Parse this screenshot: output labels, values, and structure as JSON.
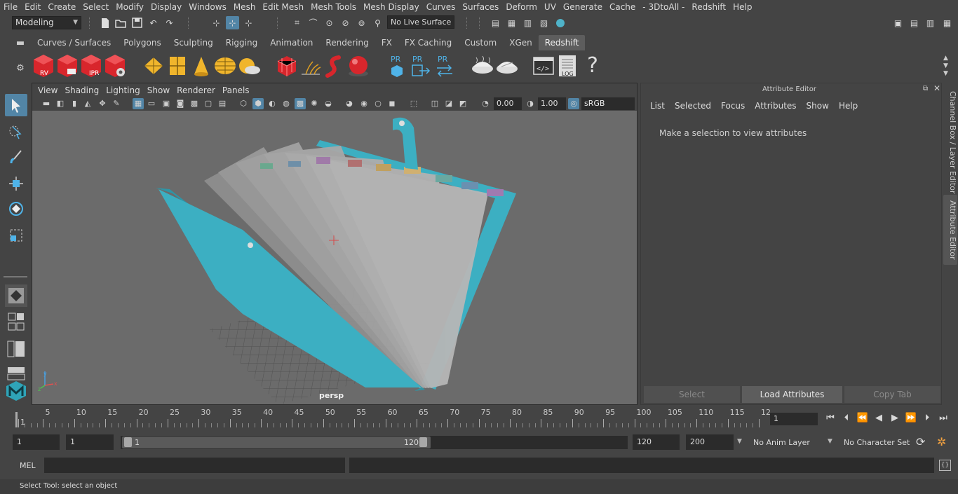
{
  "menu": [
    "File",
    "Edit",
    "Create",
    "Select",
    "Modify",
    "Display",
    "Windows",
    "Mesh",
    "Edit Mesh",
    "Mesh Tools",
    "Mesh Display",
    "Curves",
    "Surfaces",
    "Deform",
    "UV",
    "Generate",
    "Cache",
    "- 3DtoAll -",
    "Redshift",
    "Help"
  ],
  "status_line": {
    "workspace": "Modeling",
    "live_surface": "No Live Surface"
  },
  "shelf": {
    "tabs": [
      "Curves / Surfaces",
      "Polygons",
      "Sculpting",
      "Rigging",
      "Animation",
      "Rendering",
      "FX",
      "FX Caching",
      "Custom",
      "XGen",
      "Redshift"
    ],
    "active_tab": "Redshift",
    "icon_labels": {
      "rv": "RV",
      "ipr": "IPR",
      "pr1": "PR",
      "pr2": "PR",
      "pr3": "PR",
      "log": "LOG",
      "help": "?"
    }
  },
  "viewport": {
    "menu": [
      "View",
      "Shading",
      "Lighting",
      "Show",
      "Renderer",
      "Panels"
    ],
    "near_value": "0.00",
    "far_value": "1.00",
    "color_space": "sRGB gamma",
    "camera_label": "persp"
  },
  "attribute_editor": {
    "title": "Attribute Editor",
    "menu": [
      "List",
      "Selected",
      "Focus",
      "Attributes",
      "Show",
      "Help"
    ],
    "message": "Make a selection to view attributes",
    "buttons": {
      "select": "Select",
      "load": "Load Attributes",
      "copy": "Copy Tab"
    },
    "side_tabs": {
      "channel_box": "Channel Box / Layer Editor",
      "attribute_editor": "Attribute Editor"
    }
  },
  "time_slider": {
    "ticks": [
      "1",
      "5",
      "10",
      "15",
      "20",
      "25",
      "30",
      "35",
      "40",
      "45",
      "50",
      "55",
      "60",
      "65",
      "70",
      "75",
      "80",
      "85",
      "90",
      "95",
      "100",
      "105",
      "110",
      "115",
      "12"
    ],
    "current_frame": "1"
  },
  "range_slider": {
    "start_time": "1",
    "start_playback": "1",
    "handle_start": "1",
    "handle_end": "120",
    "end_playback": "120",
    "end_time": "200",
    "anim_layer": "No Anim Layer",
    "character_set": "No Character Set"
  },
  "command_line": {
    "label": "MEL"
  },
  "help_line": "Select Tool: select an object",
  "colors": {
    "accent": "#5285a6",
    "folder": "#3cafc2",
    "background": "#444444",
    "viewport": "#6b6b6b"
  }
}
